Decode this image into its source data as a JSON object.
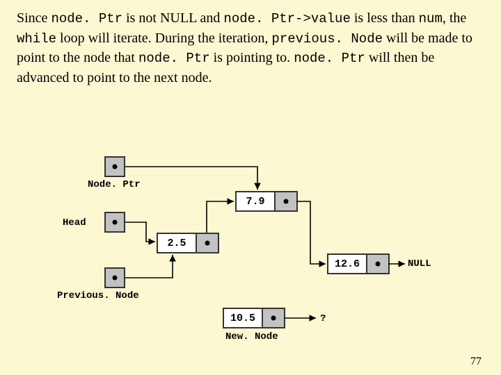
{
  "paragraph": {
    "t1": "Since ",
    "c1": "node. Ptr",
    "t2": " is not NULL and ",
    "c2": "node. Ptr->value",
    "t3": " is less than ",
    "c3": "num",
    "t4": ", the ",
    "c4": "while",
    "t5": " loop will iterate. During the iteration, ",
    "c5": "previous. Node",
    "t6": " will be made to point to the node that ",
    "c6": "node. Ptr",
    "t7": " is pointing to. ",
    "c7": "node. Ptr",
    "t8": " will then be advanced to point to the next node."
  },
  "labels": {
    "nodeptr": "Node. Ptr",
    "head": "Head",
    "prev": "Previous. Node",
    "newnode": "New. Node",
    "null": "NULL",
    "unknown": "?"
  },
  "nodes": {
    "n1": "2.5",
    "n2": "7.9",
    "n3": "12.6",
    "n4": "10.5"
  },
  "pagenum": "77"
}
